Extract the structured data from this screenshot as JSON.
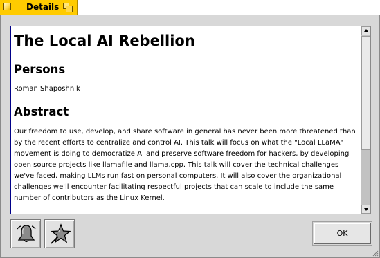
{
  "window": {
    "title": "Details"
  },
  "document": {
    "title": "The Local AI Rebellion",
    "persons_heading": "Persons",
    "persons": "Roman Shaposhnik",
    "abstract_heading": "Abstract",
    "abstract": "Our freedom to use, develop, and share software in general has never been more threatened than by the recent efforts to centralize and control AI. This talk will focus on what the \"Local LLaMA\" movement is doing to democratize AI and preserve software freedom for hackers, by developing open source projects like llamafile and llama.cpp. This talk will cover the technical challenges we've faced, making LLMs run fast on personal computers. It will also cover the organizational challenges we'll encounter facilitating respectful projects that can scale to include the same number of contributors as the Linux Kernel."
  },
  "buttons": {
    "ok_label": "OK",
    "alarm_icon": "alarm-bell-icon",
    "favorite_icon": "star-icon"
  },
  "colors": {
    "tab_yellow": "#ffcb00",
    "frame_grey": "#d8d8d8",
    "text_border": "#000088"
  }
}
